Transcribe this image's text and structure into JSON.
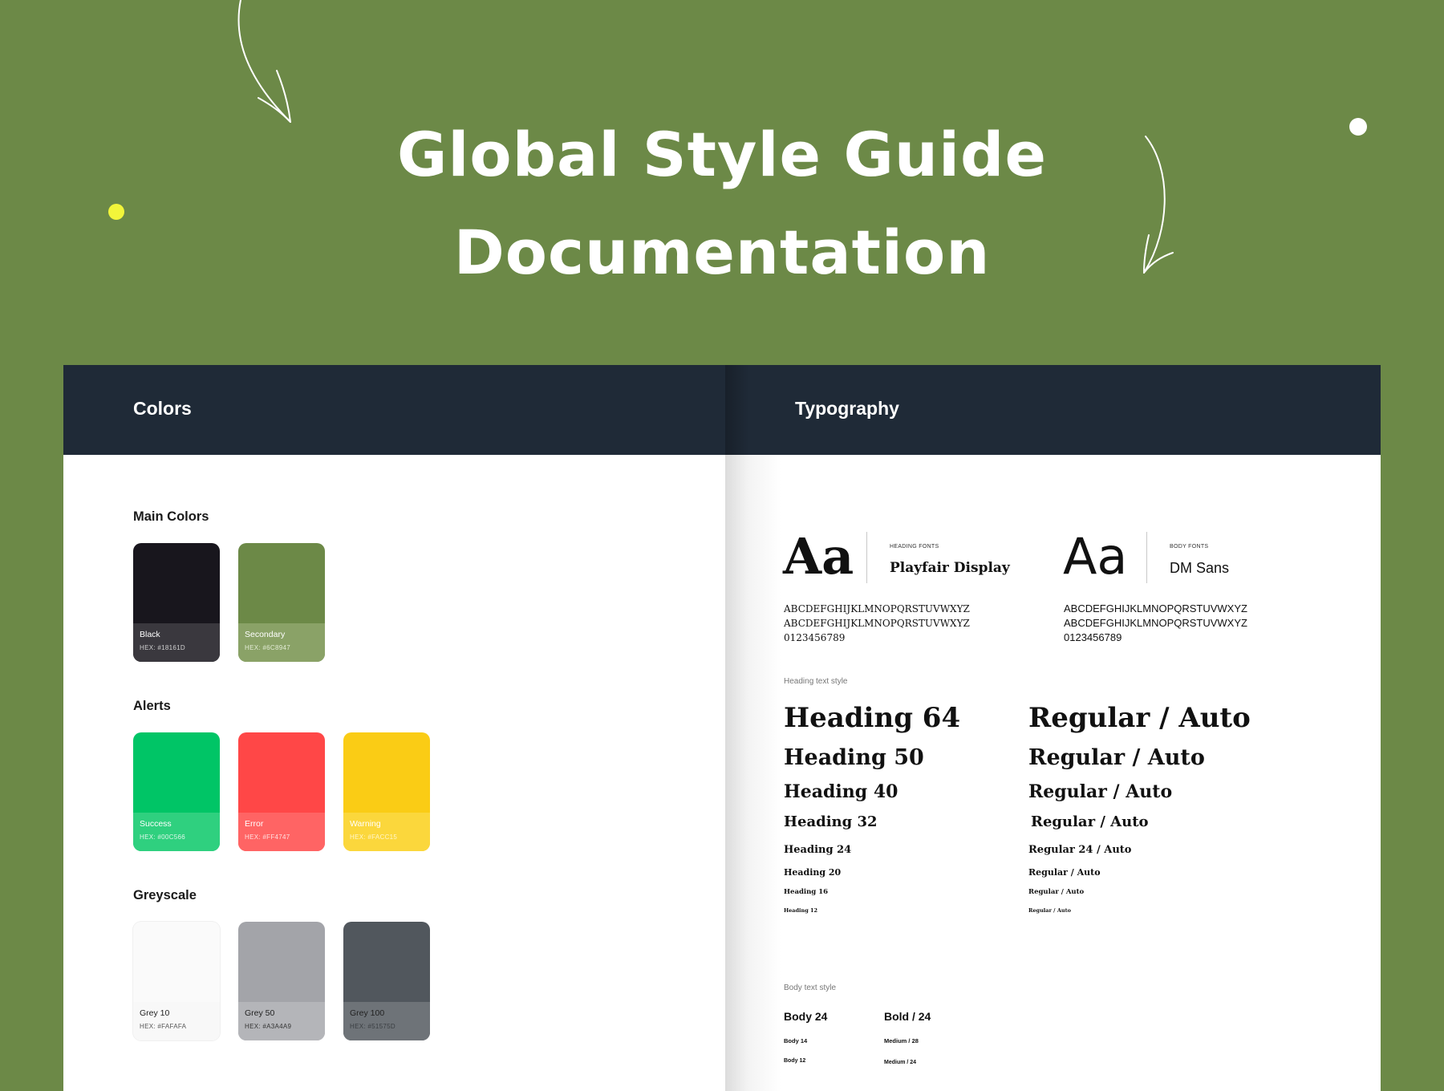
{
  "hero": {
    "title_line1": "Global Style Guide",
    "title_line2": "Documentation"
  },
  "decor": {
    "yellow_dot_color": "#f2f53a",
    "white_dot_color": "#ffffff",
    "arrow_color": "#ffffff"
  },
  "colors_panel": {
    "title": "Colors",
    "sections": [
      {
        "label": "Main Colors"
      },
      {
        "label": "Alerts"
      },
      {
        "label": "Greyscale"
      }
    ],
    "main": [
      {
        "name": "Black",
        "hex": "HEX: #18161D",
        "color": "#18161d",
        "band": "#3a383e",
        "text": "#ffffff"
      },
      {
        "name": "Secondary",
        "hex": "HEX: #6C8947",
        "color": "#6c8947",
        "band": "#8aa267",
        "text": "#ffffff"
      }
    ],
    "alerts": [
      {
        "name": "Success",
        "hex": "HEX: #00C566",
        "color": "#00c566",
        "band": "#2fd07f",
        "text": "#ffffff"
      },
      {
        "name": "Error",
        "hex": "HEX: #FF4747",
        "color": "#ff4747",
        "band": "#ff6464",
        "text": "#ffffff"
      },
      {
        "name": "Warning",
        "hex": "HEX: #FACC15",
        "color": "#facc15",
        "band": "#fbd73c",
        "text": "#ffffff"
      }
    ],
    "greyscale": [
      {
        "name": "Grey 10",
        "hex": "HEX: #FAFAFA",
        "color": "#fafafa",
        "band": "#f8f8f8",
        "text": "#222222"
      },
      {
        "name": "Grey 50",
        "hex": "HEX: #A3A4A9",
        "color": "#a3a4a9",
        "band": "#b4b5b9",
        "text": "#222222"
      },
      {
        "name": "Grey 100",
        "hex": "HEX: #51575D",
        "color": "#51575d",
        "band": "#6e7378",
        "text": "#222222"
      }
    ]
  },
  "typography_panel": {
    "title": "Typography",
    "heading_font": {
      "sample": "Aa",
      "kicker": "HEADING FONTS",
      "name": "Playfair Display",
      "alphabet": "ABCDEFGHIJKLMNOPQRSTUVWXYZ\nABCDEFGHIJKLMNOPQRSTUVWXYZ\n0123456789"
    },
    "body_font": {
      "sample": "Aa",
      "kicker": "BODY FONTS",
      "name": "DM Sans",
      "alphabet": "ABCDEFGHIJKLMNOPQRSTUVWXYZ\nABCDEFGHIJKLMNOPQRSTUVWXYZ\n0123456789"
    },
    "heading_style_label": "Heading text style",
    "headings": [
      {
        "name": "Heading 64",
        "spec": "Regular / Auto"
      },
      {
        "name": "Heading 50",
        "spec": "Regular / Auto"
      },
      {
        "name": "Heading 40",
        "spec": "Regular / Auto"
      },
      {
        "name": "Heading 32",
        "spec": "Regular / Auto"
      },
      {
        "name": "Heading 24",
        "spec": "Regular 24 / Auto"
      },
      {
        "name": "Heading 20",
        "spec": "Regular / Auto"
      },
      {
        "name": "Heading 16",
        "spec": "Regular / Auto"
      },
      {
        "name": "Heading 12",
        "spec": "Regular / Auto"
      }
    ],
    "body_style_label": "Body text style",
    "body_styles": [
      {
        "name": "Body 24",
        "spec": "Bold / 24"
      },
      {
        "name": "Body 14",
        "spec": "Medium / 28"
      },
      {
        "name": "Body 12",
        "spec": "Medium / 24"
      }
    ]
  }
}
